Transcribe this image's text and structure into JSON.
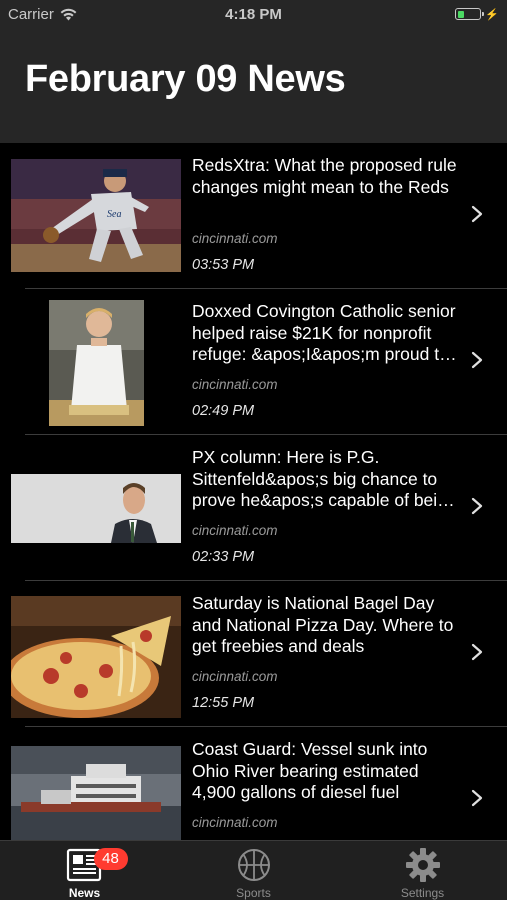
{
  "status_bar": {
    "carrier": "Carrier",
    "time": "4:18 PM",
    "battery_level": 0.3
  },
  "header": {
    "title": "February 09 News"
  },
  "articles": [
    {
      "title": "RedsXtra: What the proposed rule changes might mean to the Reds",
      "source": "cincinnati.com",
      "time": "03:53 PM",
      "thumbnail": "baseball-pitcher-image"
    },
    {
      "title": "Doxxed Covington Catholic senior helped raise $21K for nonprofit refuge: &apos;I&apos;m proud to help&apos;",
      "source": "cincinnati.com",
      "time": "02:49 PM",
      "thumbnail": "chef-portrait-image"
    },
    {
      "title": "PX column: Here is P.G. Sittenfeld&apos;s big chance to prove he&apos;s capable of being mayor",
      "source": "cincinnati.com",
      "time": "02:33 PM",
      "thumbnail": "man-in-suit-image"
    },
    {
      "title": "Saturday is National Bagel Day and National Pizza Day. Where to get freebies and deals",
      "source": "cincinnati.com",
      "time": "12:55 PM",
      "thumbnail": "pizza-image"
    },
    {
      "title": "Coast Guard: Vessel sunk into Ohio River bearing estimated 4,900 gallons of diesel fuel",
      "source": "cincinnati.com",
      "time": "",
      "thumbnail": "river-boat-image"
    }
  ],
  "tab_bar": {
    "tabs": [
      {
        "label": "News",
        "icon": "newspaper-icon",
        "badge": "48",
        "active": true
      },
      {
        "label": "Sports",
        "icon": "basketball-icon",
        "active": false
      },
      {
        "label": "Settings",
        "icon": "gear-icon",
        "active": false
      }
    ]
  },
  "colors": {
    "header_bg": "#262626",
    "list_bg": "#000000",
    "badge": "#ff3b30",
    "battery": "#4cd964"
  }
}
